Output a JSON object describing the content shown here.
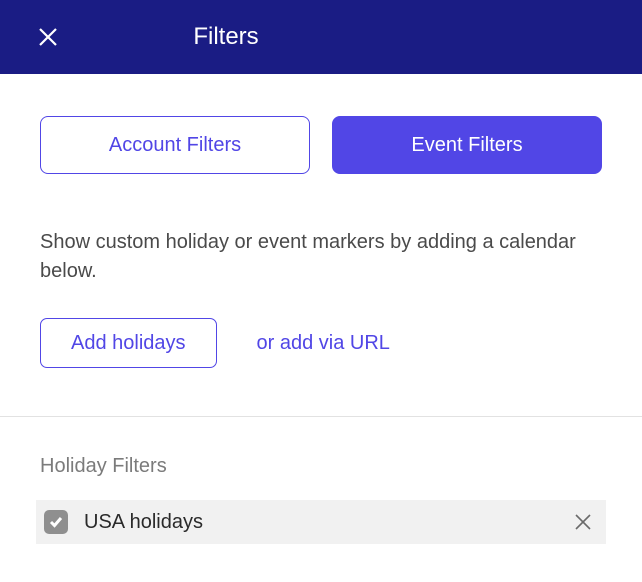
{
  "header": {
    "title": "Filters"
  },
  "tabs": {
    "account": "Account Filters",
    "event": "Event Filters"
  },
  "description": "Show custom holiday or event markers by adding a calendar below.",
  "actions": {
    "add_holidays": "Add holidays",
    "add_via_url": "or add via URL"
  },
  "section": {
    "label": "Holiday Filters"
  },
  "filters": [
    {
      "label": "USA holidays",
      "checked": true
    }
  ]
}
